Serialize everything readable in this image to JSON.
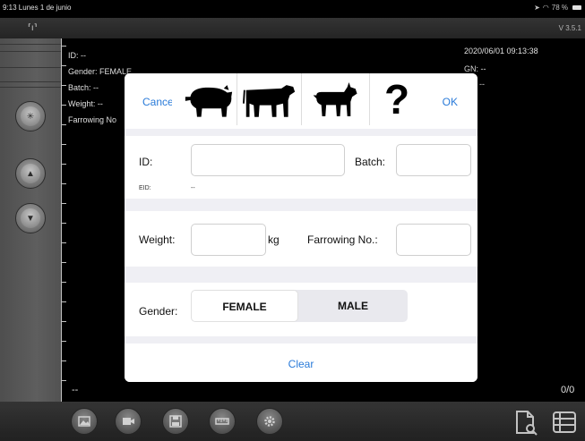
{
  "status_bar": {
    "time_date": "9:13  Lunes 1 de junio",
    "battery": "78 %"
  },
  "app_bar": {
    "version": "V 3.5.1"
  },
  "background": {
    "id_line": "ID: --",
    "gender_line": "Gender: FEMALE",
    "batch_line": "Batch: --",
    "weight_line": "Weight: --",
    "farrowing_line": "Farrowing No",
    "datetime": "2020/06/01 09:13:38",
    "gn_line": "GN: --",
    "dash_right": "--",
    "bottom_dash": "--",
    "counter": "0/0"
  },
  "modal": {
    "cancel_label": "Cancel",
    "ok_label": "OK",
    "help_glyph": "?",
    "id_label": "ID:",
    "id_value": "",
    "batch_label": "Batch:",
    "batch_value": "",
    "eid_label": "EID:",
    "eid_value": "--",
    "weight_label": "Weight:",
    "weight_value": "",
    "weight_unit": "kg",
    "farrowing_label": "Farrowing No.:",
    "farrowing_value": "",
    "gender_label": "Gender:",
    "gender_options": [
      "FEMALE",
      "MALE"
    ],
    "gender_selected": "FEMALE",
    "clear_label": "Clear"
  },
  "icons": {
    "animals": [
      "pig-icon",
      "cow-icon",
      "goat-icon"
    ],
    "toolbar": [
      "image-icon",
      "video-icon",
      "save-icon",
      "ruler-icon",
      "gear-icon"
    ],
    "right": [
      "document-search-icon",
      "list-icon"
    ]
  }
}
